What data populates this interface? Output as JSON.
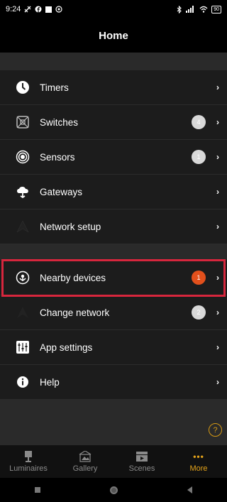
{
  "status": {
    "time": "9:24",
    "battery": "90"
  },
  "header": {
    "title": "Home"
  },
  "menu_group_1": [
    {
      "label": "Timers",
      "badge": ""
    },
    {
      "label": "Switches",
      "badge": "4"
    },
    {
      "label": "Sensors",
      "badge": "1"
    },
    {
      "label": "Gateways",
      "badge": ""
    },
    {
      "label": "Network setup",
      "badge": ""
    }
  ],
  "menu_group_2": [
    {
      "label": "Nearby devices",
      "badge": "1"
    },
    {
      "label": "Change network",
      "badge": "2"
    },
    {
      "label": "App settings",
      "badge": ""
    },
    {
      "label": "Help",
      "badge": ""
    }
  ],
  "help_symbol": "?",
  "tabs": [
    {
      "label": "Luminaires",
      "active": false
    },
    {
      "label": "Gallery",
      "active": false
    },
    {
      "label": "Scenes",
      "active": false
    },
    {
      "label": "More",
      "active": true,
      "icon_text": "•••"
    }
  ],
  "colors": {
    "accent": "#e3a21a",
    "alert": "#e2501c",
    "highlight": "#d7263d"
  }
}
